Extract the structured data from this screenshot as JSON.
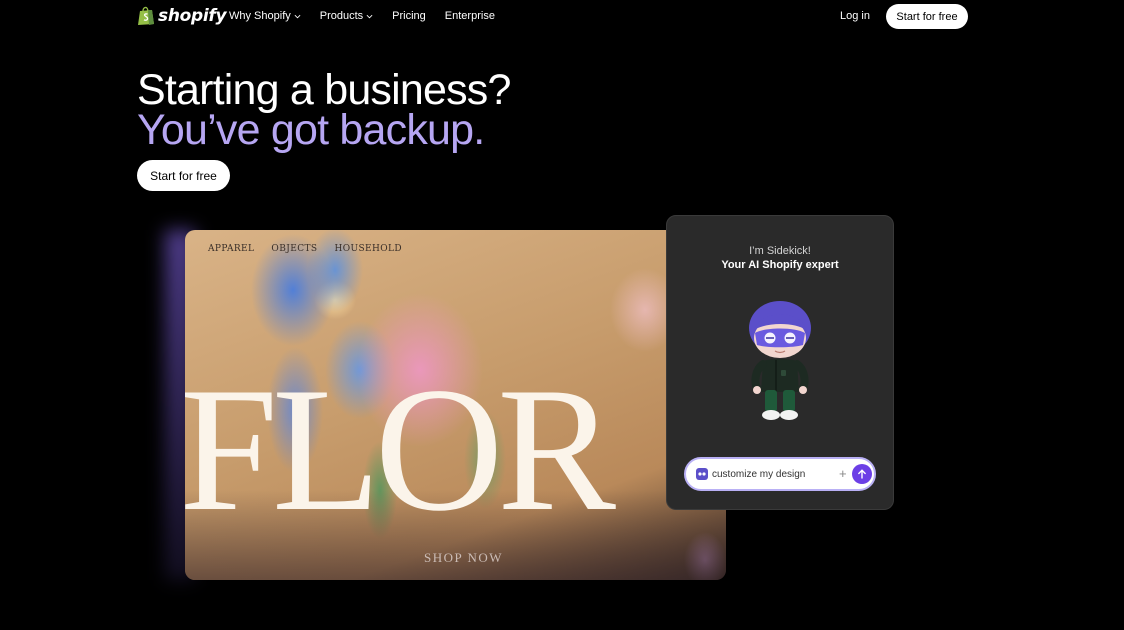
{
  "nav": {
    "logo_text": "shopify",
    "links": [
      {
        "label": "Why Shopify",
        "has_dropdown": true
      },
      {
        "label": "Products",
        "has_dropdown": true
      },
      {
        "label": "Pricing",
        "has_dropdown": false
      },
      {
        "label": "Enterprise",
        "has_dropdown": false
      }
    ],
    "login_label": "Log in",
    "cta_label": "Start for free"
  },
  "hero": {
    "headline": "Starting a business?",
    "subheadline": "You’ve got backup.",
    "cta_label": "Start for free",
    "accent_color": "#b6a6f2"
  },
  "store_preview": {
    "nav_items": [
      "APPAREL",
      "OBJECTS",
      "HOUSEHOLD"
    ],
    "hero_word": "FLOR",
    "shop_label": "SHOP NOW"
  },
  "sidekick": {
    "intro": "I’m Sidekick!",
    "tagline": "Your AI Shopify expert",
    "input_value": "customize my design",
    "send_color": "#6c3fe6"
  },
  "icons": [
    "shopify-bag-icon",
    "chevron-down-icon",
    "sidekick-character",
    "sidekick-app-icon",
    "plus-icon",
    "arrow-up-icon"
  ]
}
